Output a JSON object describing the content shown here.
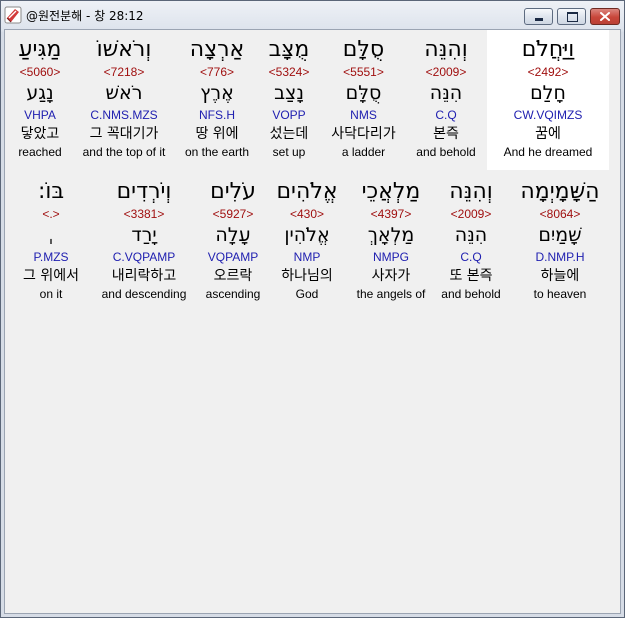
{
  "window": {
    "title": "@원전분해 - 창 28:12",
    "app_icon": "app-icon",
    "controls": [
      {
        "name": "minimize",
        "icon": "minimize-icon"
      },
      {
        "name": "maximize",
        "icon": "maximize-icon"
      },
      {
        "name": "close",
        "icon": "close-icon"
      }
    ]
  },
  "colors": {
    "strongs_number": "#a01010",
    "parsing_code": "#2020b0",
    "selected_background": "#ffffff",
    "panel_background": "#f0f0f0",
    "close_button": "#c9463a"
  },
  "verse": {
    "rows": [
      {
        "words": [
          {
            "hebrew": "וַיַּחֲלֹם",
            "strong": "<2492>",
            "lemma": "חָלַם",
            "parse": "CW.VQIMZS",
            "korean": "꿈에",
            "english": "And he dreamed",
            "selected": true
          },
          {
            "hebrew": "וְהִנֵּה",
            "strong": "<2009>",
            "lemma": "הִנֵּה",
            "parse": "C.Q",
            "korean": "본즉",
            "english": "and behold"
          },
          {
            "hebrew": "סֻלָּם",
            "strong": "<5551>",
            "lemma": "סֻלָּם",
            "parse": "NMS",
            "korean": "사닥다리가",
            "english": "a ladder"
          },
          {
            "hebrew": "מֻצָּב",
            "strong": "<5324>",
            "lemma": "נָצַב",
            "parse": "VOPP",
            "korean": "섰는데",
            "english": "set up"
          },
          {
            "hebrew": "אַרְצָה",
            "strong": "<776>",
            "lemma": "אֶרֶץ",
            "parse": "NFS.H",
            "korean": "땅 위에",
            "english": "on the earth"
          },
          {
            "hebrew": "וְרֹאשׁוֹ",
            "strong": "<7218>",
            "lemma": "רֹאשׁ",
            "parse": "C.NMS.MZS",
            "korean": "그 꼭대기가",
            "english": "and the top of it"
          },
          {
            "hebrew": "מַגִּיעַ",
            "strong": "<5060>",
            "lemma": "נָגַע",
            "parse": "VHPA",
            "korean": "닿았고",
            "english": "reached"
          }
        ]
      },
      {
        "words": [
          {
            "hebrew": "הַשָּׁמָיְמָה",
            "strong": "<8064>",
            "lemma": "שָׁמַיִם",
            "parse": "D.NMP.H",
            "korean": "하늘에",
            "english": "to heaven"
          },
          {
            "hebrew": "וְהִנֵּה",
            "strong": "<2009>",
            "lemma": "הִנֵּה",
            "parse": "C.Q",
            "korean": "또 본즉",
            "english": "and behold"
          },
          {
            "hebrew": "מַלְאֲכֵי",
            "strong": "<4397>",
            "lemma": "מַלְאָךְ",
            "parse": "NMPG",
            "korean": "사자가",
            "english": "the angels of"
          },
          {
            "hebrew": "אֱלֹהִים",
            "strong": "<430>",
            "lemma": "אֱלֹהִין",
            "parse": "NMP",
            "korean": "하나님의",
            "english": "God"
          },
          {
            "hebrew": "עֹלִים",
            "strong": "<5927>",
            "lemma": "עָלָה",
            "parse": "VQPAMP",
            "korean": "오르락",
            "english": "ascending"
          },
          {
            "hebrew": "וְיֹרְדִים",
            "strong": "<3381>",
            "lemma": "יָרַד",
            "parse": "C.VQPAMP",
            "korean": "내리락하고",
            "english": "and descending"
          },
          {
            "hebrew": "בּוֹ:",
            "strong": "<.>",
            "lemma": "ˌ",
            "parse": "P.MZS",
            "korean": "그 위에서",
            "english": "on it"
          }
        ]
      }
    ]
  }
}
